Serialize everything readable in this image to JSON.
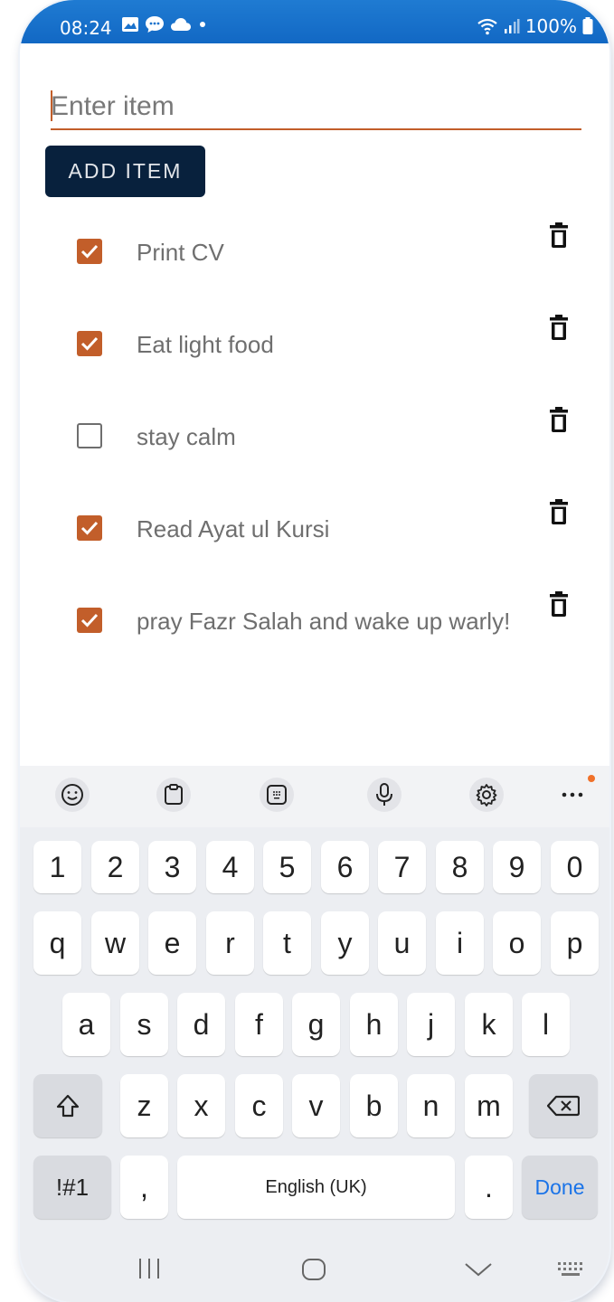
{
  "status": {
    "time": "08:24",
    "battery": "100%"
  },
  "form": {
    "placeholder": "Enter item",
    "add_label": "ADD ITEM"
  },
  "items": [
    {
      "label": "Print CV",
      "checked": true
    },
    {
      "label": "Eat light food",
      "checked": true
    },
    {
      "label": "stay calm",
      "checked": false
    },
    {
      "label": "Read Ayat ul Kursi",
      "checked": true
    },
    {
      "label": "pray Fazr Salah and wake up warly!",
      "checked": true
    }
  ],
  "keyboard": {
    "toolbar": [
      "emoji-icon",
      "clipboard-icon",
      "keypad-icon",
      "microphone-icon",
      "gear-icon",
      "more-icon"
    ],
    "row1": [
      "1",
      "2",
      "3",
      "4",
      "5",
      "6",
      "7",
      "8",
      "9",
      "0"
    ],
    "row2": [
      "q",
      "w",
      "e",
      "r",
      "t",
      "y",
      "u",
      "i",
      "o",
      "p"
    ],
    "row3": [
      "a",
      "s",
      "d",
      "f",
      "g",
      "h",
      "j",
      "k",
      "l"
    ],
    "row4": [
      "z",
      "x",
      "c",
      "v",
      "b",
      "n",
      "m"
    ],
    "symbols_label": "!#1",
    "comma": ",",
    "space_label": "English (UK)",
    "period": ".",
    "done_label": "Done"
  },
  "colors": {
    "accent": "#c25e2a",
    "button": "#08213d",
    "statusbar": "#1a72cc",
    "done": "#1a73e8"
  }
}
